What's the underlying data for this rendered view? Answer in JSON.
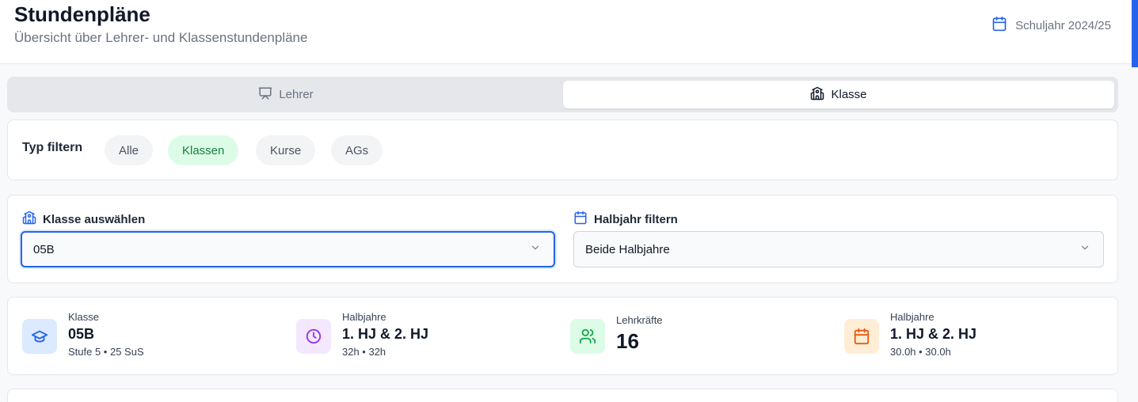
{
  "header": {
    "title": "Stundenpläne",
    "subtitle": "Übersicht über Lehrer- und Klassenstundenpläne",
    "school_year": "Schuljahr 2024/25"
  },
  "tabs": [
    {
      "label": "Lehrer",
      "icon": "presentation-icon",
      "active": false
    },
    {
      "label": "Klasse",
      "icon": "school-icon",
      "active": true
    }
  ],
  "filter": {
    "label": "Typ filtern",
    "options": [
      {
        "label": "Alle",
        "active": false
      },
      {
        "label": "Klassen",
        "active": true
      },
      {
        "label": "Kurse",
        "active": false
      },
      {
        "label": "AGs",
        "active": false
      }
    ]
  },
  "selects": {
    "class": {
      "label": "Klasse auswählen",
      "value": "05B"
    },
    "term": {
      "label": "Halbjahr filtern",
      "value": "Beide Halbjahre"
    }
  },
  "stats": [
    {
      "label": "Klasse",
      "value": "05B",
      "sub": "Stufe 5 • 25 SuS",
      "icon": "graduation-cap-icon",
      "color": "#2563eb",
      "bg": "#dbeafe"
    },
    {
      "label": "Halbjahre",
      "value": "1. HJ & 2. HJ",
      "sub": "32h • 32h",
      "icon": "clock-icon",
      "color": "#9333ea",
      "bg": "#f3e8ff"
    },
    {
      "label": "Lehrkräfte",
      "value": "16",
      "sub": "",
      "icon": "users-icon",
      "color": "#16a34a",
      "bg": "#dcfce7"
    },
    {
      "label": "Halbjahre",
      "value": "1. HJ & 2. HJ",
      "sub": "30.0h • 30.0h",
      "icon": "calendar-icon",
      "color": "#ea580c",
      "bg": "#ffedd5"
    }
  ],
  "colors": {
    "accent": "#2563eb",
    "active_green": "#15803d"
  }
}
